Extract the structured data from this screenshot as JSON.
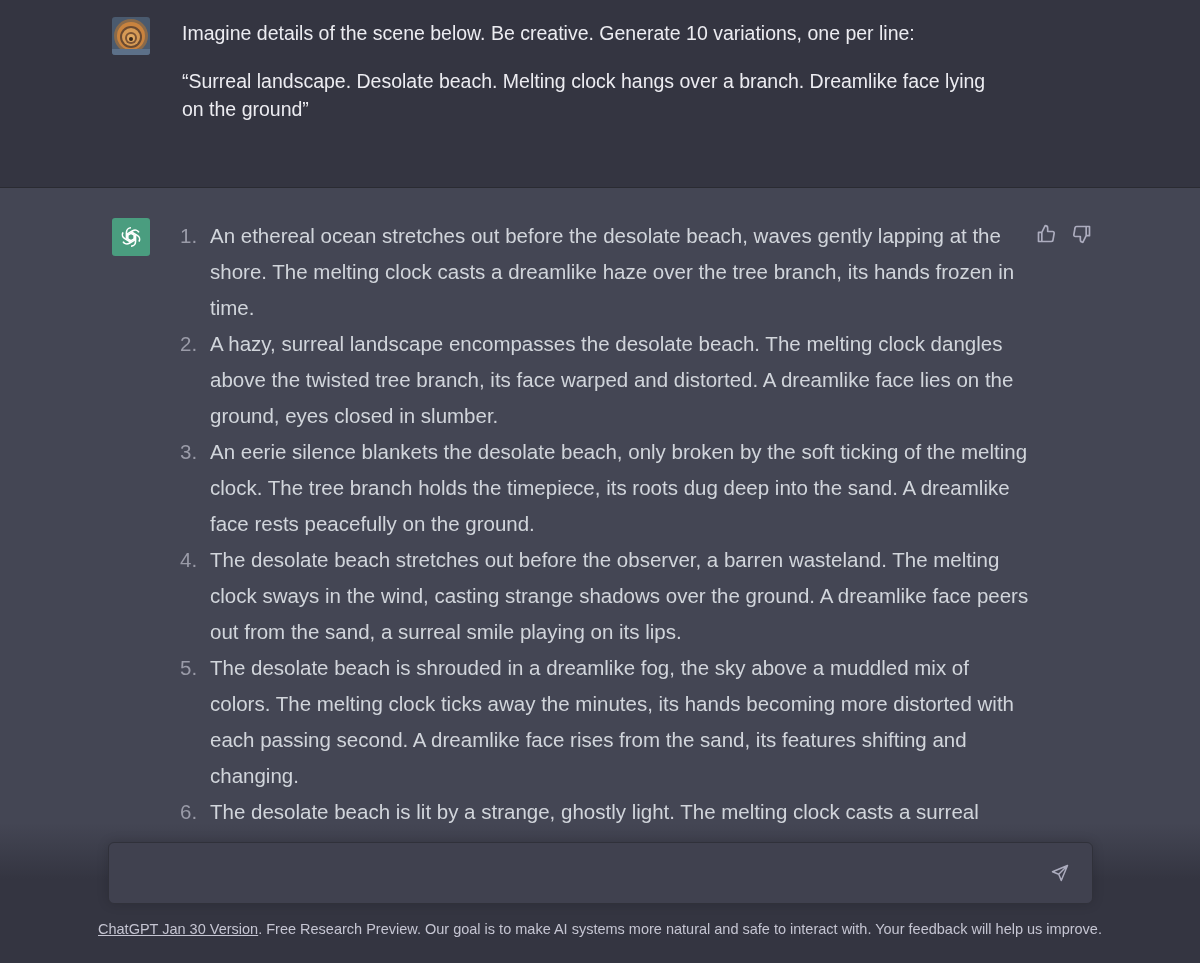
{
  "prompt": {
    "paragraphs": [
      "Imagine details of the scene below. Be creative. Generate 10 variations, one per line:",
      "“Surreal landscape. Desolate beach. Melting clock hangs over a branch. Dreamlike face lying on the ground”"
    ]
  },
  "response": {
    "items": [
      {
        "number": "1.",
        "text": "An ethereal ocean stretches out before the desolate beach, waves gently lapping at the shore. The melting clock casts a dreamlike haze over the tree branch, its hands frozen in time."
      },
      {
        "number": "2.",
        "text": "A hazy, surreal landscape encompasses the desolate beach. The melting clock dangles above the twisted tree branch, its face warped and distorted. A dreamlike face lies on the ground, eyes closed in slumber."
      },
      {
        "number": "3.",
        "text": "An eerie silence blankets the desolate beach, only broken by the soft ticking of the melting clock. The tree branch holds the timepiece, its roots dug deep into the sand. A dreamlike face rests peacefully on the ground."
      },
      {
        "number": "4.",
        "text": "The desolate beach stretches out before the observer, a barren wasteland. The melting clock sways in the wind, casting strange shadows over the ground. A dreamlike face peers out from the sand, a surreal smile playing on its lips."
      },
      {
        "number": "5.",
        "text": "The desolate beach is shrouded in a dreamlike fog, the sky above a muddled mix of colors. The melting clock ticks away the minutes, its hands becoming more distorted with each passing second. A dreamlike face rises from the sand, its features shifting and changing."
      },
      {
        "number": "6.",
        "text": "The desolate beach is lit by a strange, ghostly light. The melting clock casts a surreal"
      }
    ]
  },
  "footer": {
    "link": "ChatGPT Jan 30 Version",
    "text": ". Free Research Preview. Our goal is to make AI systems more natural and safe to interact with. Your feedback will help us improve."
  }
}
